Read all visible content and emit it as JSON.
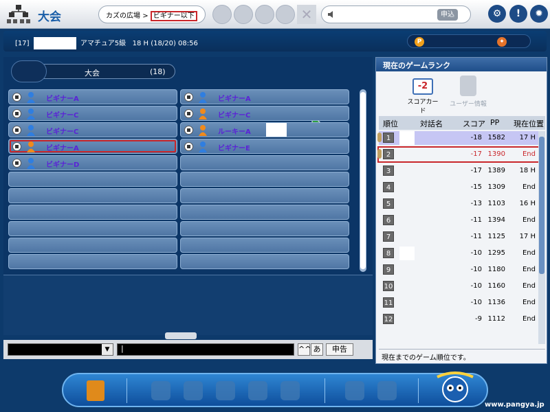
{
  "header": {
    "title": "大会",
    "breadcrumb": {
      "parent": "カズの広場",
      "separator": ">",
      "current": "ビギナー以下"
    },
    "apply_label": "申込"
  },
  "info": {
    "id": "[17]",
    "rank": "アマチュア5級",
    "hole_status": "18 H (18/20)",
    "time": "08:56"
  },
  "room": {
    "name": "大会",
    "count": "(18)"
  },
  "players": [
    {
      "name": "ビギナーA",
      "col": 0,
      "row": 0,
      "avatar": "blue",
      "highlight": false,
      "blank": false
    },
    {
      "name": "ビギナーA",
      "col": 1,
      "row": 0,
      "avatar": "blue",
      "highlight": false,
      "blank": false
    },
    {
      "name": "ビギナーC",
      "col": 0,
      "row": 1,
      "avatar": "blue",
      "highlight": false,
      "blank": false
    },
    {
      "name": "ビギナーC",
      "col": 1,
      "row": 1,
      "avatar": "orange",
      "highlight": false,
      "blank": false
    },
    {
      "name": "ビギナーC",
      "col": 0,
      "row": 2,
      "avatar": "blue",
      "highlight": false,
      "blank": false
    },
    {
      "name": "ルーキーA",
      "col": 1,
      "row": 2,
      "avatar": "orange",
      "highlight": false,
      "blank": true
    },
    {
      "name": "ビギナーA",
      "col": 0,
      "row": 3,
      "avatar": "orange",
      "highlight": true,
      "blank": false
    },
    {
      "name": "ビギナーE",
      "col": 1,
      "row": 3,
      "avatar": "blue",
      "highlight": false,
      "blank": false
    },
    {
      "name": "ビギナーD",
      "col": 0,
      "row": 4,
      "avatar": "blue",
      "highlight": false,
      "blank": false
    }
  ],
  "chat": {
    "input_value": "|",
    "emote_label": "^^",
    "kana_label": "あ",
    "report_label": "申告"
  },
  "ranking": {
    "header": "現在のゲームランク",
    "score_tab_value": "-2",
    "score_tab_label": "スコアカード",
    "user_tab_label": "ユーザー情報",
    "columns": [
      "順位",
      "対話名",
      "スコア",
      "PP",
      "現在位置"
    ],
    "rows": [
      {
        "rank": "1",
        "score": "-18",
        "pp": "1582",
        "loc": "17 H",
        "first": true,
        "me": false,
        "blank": true
      },
      {
        "rank": "2",
        "score": "-17",
        "pp": "1390",
        "loc": "End",
        "first": false,
        "me": true,
        "blank": false
      },
      {
        "rank": "3",
        "score": "-17",
        "pp": "1389",
        "loc": "18 H",
        "first": false,
        "me": false,
        "blank": false
      },
      {
        "rank": "4",
        "score": "-15",
        "pp": "1309",
        "loc": "End",
        "first": false,
        "me": false,
        "blank": false
      },
      {
        "rank": "5",
        "score": "-13",
        "pp": "1103",
        "loc": "16 H",
        "first": false,
        "me": false,
        "blank": false
      },
      {
        "rank": "6",
        "score": "-11",
        "pp": "1394",
        "loc": "End",
        "first": false,
        "me": false,
        "blank": false
      },
      {
        "rank": "7",
        "score": "-11",
        "pp": "1125",
        "loc": "17 H",
        "first": false,
        "me": false,
        "blank": false
      },
      {
        "rank": "8",
        "score": "-10",
        "pp": "1295",
        "loc": "End",
        "first": false,
        "me": false,
        "blank": true
      },
      {
        "rank": "9",
        "score": "-10",
        "pp": "1180",
        "loc": "End",
        "first": false,
        "me": false,
        "blank": false
      },
      {
        "rank": "10",
        "score": "-10",
        "pp": "1160",
        "loc": "End",
        "first": false,
        "me": false,
        "blank": false
      },
      {
        "rank": "11",
        "score": "-10",
        "pp": "1136",
        "loc": "End",
        "first": false,
        "me": false,
        "blank": false
      },
      {
        "rank": "12",
        "score": "-9",
        "pp": "1112",
        "loc": "End",
        "first": false,
        "me": false,
        "blank": false
      }
    ],
    "footer": "現在までのゲーム順位です。"
  },
  "footer": {
    "url": "www.pangya.jp"
  },
  "colors": {
    "accent": "#c9262a",
    "panel": "#0b3566",
    "player_name": "#5b23d6"
  }
}
